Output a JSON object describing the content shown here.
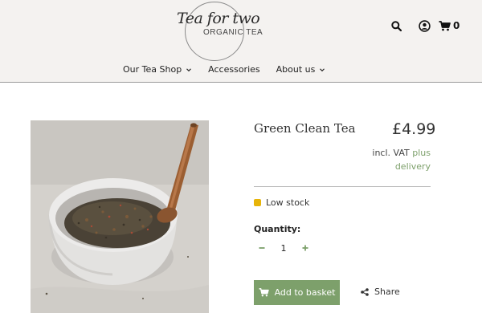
{
  "brand": {
    "script": "Tea for two",
    "subtitle": "ORGANIC TEA"
  },
  "header": {
    "cart_count": "0"
  },
  "nav": {
    "items": [
      {
        "label": "Our Tea Shop",
        "has_dropdown": true
      },
      {
        "label": "Accessories",
        "has_dropdown": false
      },
      {
        "label": "About us",
        "has_dropdown": true
      }
    ]
  },
  "product": {
    "title": "Green Clean Tea",
    "price": "£4.99",
    "vat_prefix": "incl. VAT",
    "vat_link_1": "plus",
    "vat_link_2": "delivery",
    "stock_text": "Low stock",
    "quantity_label": "Quantity:",
    "quantity_value": "1",
    "add_label": "Add to basket",
    "share_label": "Share"
  },
  "colors": {
    "accent": "#7da06b",
    "stock": "#e7b409",
    "header_bg": "#f4f2f0"
  }
}
